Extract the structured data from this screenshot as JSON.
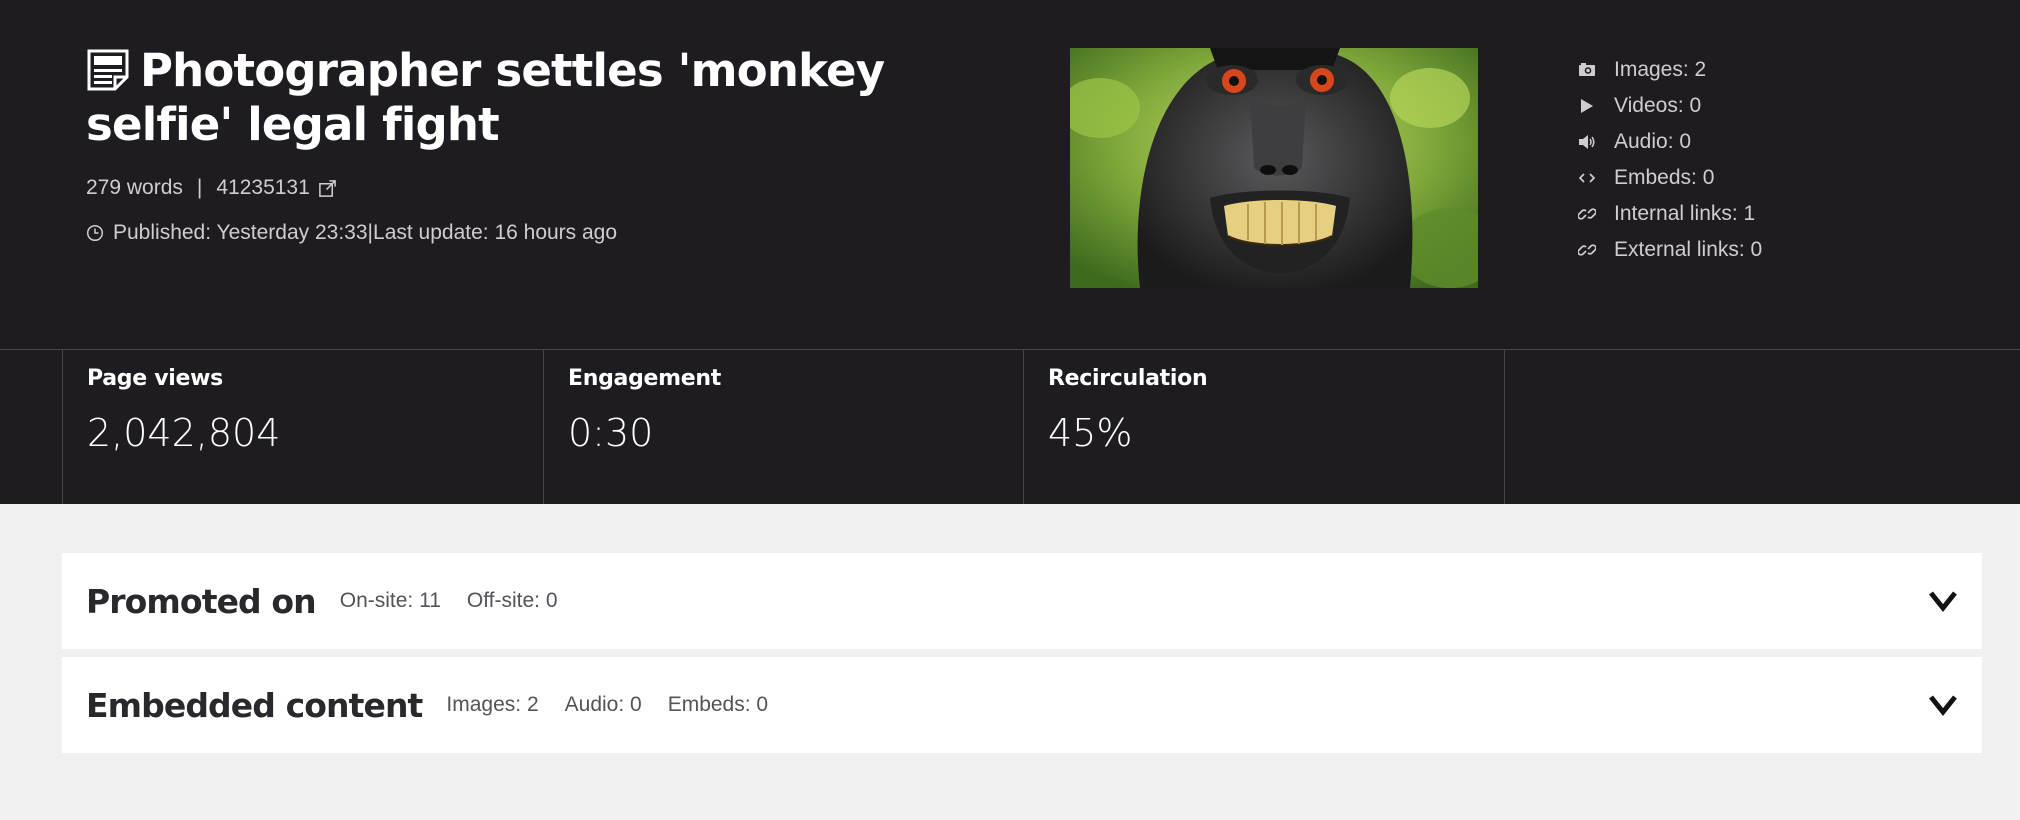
{
  "article": {
    "title": "Photographer settles 'monkey selfie' legal fight",
    "word_count": "279 words",
    "separator": "|",
    "article_id": "41235131",
    "published": "Published: Yesterday 23:33",
    "last_update": "Last update: 16 hours ago"
  },
  "media_counts": [
    {
      "icon": "camera-icon",
      "label": "Images: 2"
    },
    {
      "icon": "play-icon",
      "label": "Videos: 0"
    },
    {
      "icon": "speaker-icon",
      "label": "Audio: 0"
    },
    {
      "icon": "embed-code-icon",
      "label": "Embeds: 0"
    },
    {
      "icon": "link-icon",
      "label": "Internal links: 1"
    },
    {
      "icon": "link-icon",
      "label": "External links: 0"
    }
  ],
  "metrics": [
    {
      "label": "Page views",
      "value": "2,042,804"
    },
    {
      "label": "Engagement",
      "value": "0:30"
    },
    {
      "label": "Recirculation",
      "value": "45%"
    }
  ],
  "panels": {
    "promoted": {
      "title": "Promoted on",
      "stats": [
        "On-site: 11",
        "Off-site: 0"
      ]
    },
    "embedded": {
      "title": "Embedded content",
      "stats": [
        "Images: 2",
        "Audio: 0",
        "Embeds: 0"
      ]
    }
  },
  "colors": {
    "header_bg": "#1e1c20",
    "page_bg": "#f0f0f1",
    "panel_bg": "#ffffff",
    "divider": "#48464b"
  }
}
